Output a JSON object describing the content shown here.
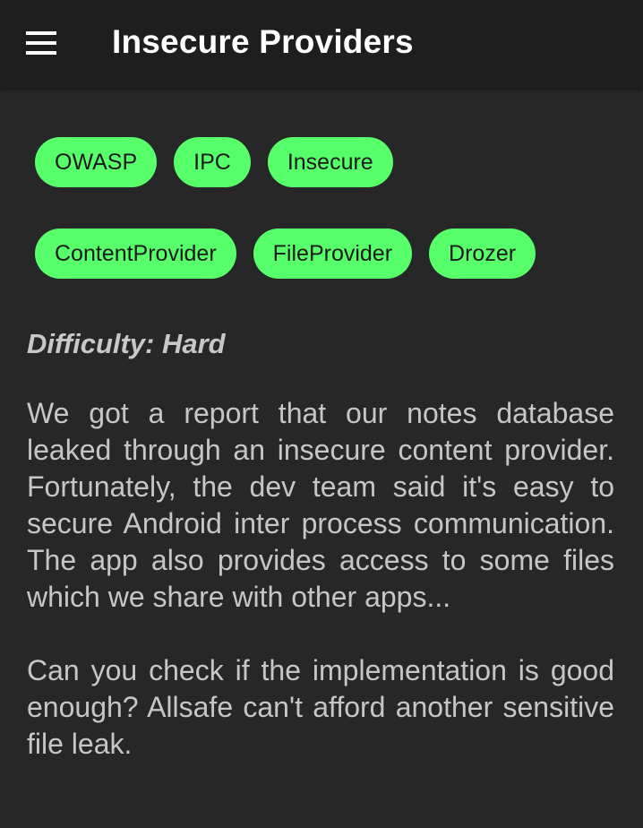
{
  "app_bar": {
    "title": "Insecure Providers",
    "menu_icon": "hamburger-menu-icon",
    "background": "#1e1e1e"
  },
  "tags": {
    "chip_color": "#57ff6b",
    "row1": [
      "OWASP",
      "IPC",
      "Insecure"
    ],
    "row2": [
      "ContentProvider",
      "FileProvider",
      "Drozer"
    ]
  },
  "difficulty": "Difficulty: Hard",
  "description": {
    "paragraph1": "We got a report that our notes database leaked through an insecure content provider. Fortunately, the dev team said it's easy to secure Android inter process communication. The app also provides access to some files which we share with other apps...",
    "paragraph2": "Can you check if the implementation is good enough? Allsafe can't afford another sensitive file leak."
  },
  "colors": {
    "background": "#272727",
    "text": "#c6c6c6",
    "title": "#ffffff"
  }
}
